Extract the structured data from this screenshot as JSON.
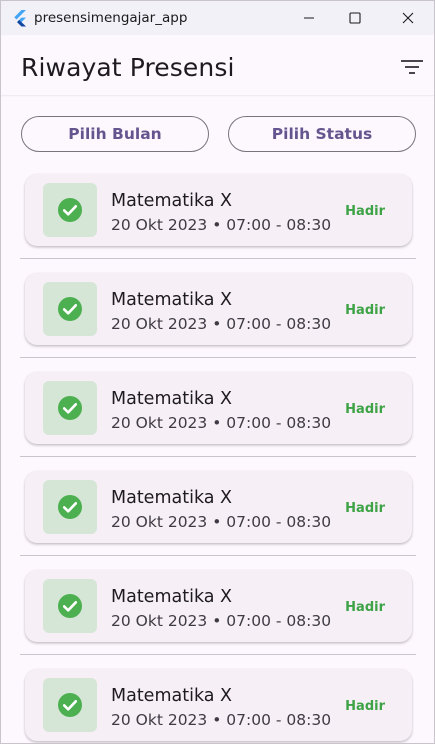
{
  "window": {
    "title": "presensimengajar_app"
  },
  "appbar": {
    "title": "Riwayat Presensi",
    "filter_icon": "filter-list-icon"
  },
  "filters": {
    "month_label": "Pilih Bulan",
    "status_label": "Pilih Status"
  },
  "colors": {
    "accent": "#65558f",
    "present": "#4caf50",
    "present_bg": "#d5e6d6",
    "card_bg": "#f6eff6"
  },
  "records": [
    {
      "subject": "Matematika X",
      "schedule": "20 Okt 2023 • 07:00 - 08:30",
      "status": "Hadir",
      "icon": "check-circle-icon"
    },
    {
      "subject": "Matematika X",
      "schedule": "20 Okt 2023 • 07:00 - 08:30",
      "status": "Hadir",
      "icon": "check-circle-icon"
    },
    {
      "subject": "Matematika X",
      "schedule": "20 Okt 2023 • 07:00 - 08:30",
      "status": "Hadir",
      "icon": "check-circle-icon"
    },
    {
      "subject": "Matematika X",
      "schedule": "20 Okt 2023 • 07:00 - 08:30",
      "status": "Hadir",
      "icon": "check-circle-icon"
    },
    {
      "subject": "Matematika X",
      "schedule": "20 Okt 2023 • 07:00 - 08:30",
      "status": "Hadir",
      "icon": "check-circle-icon"
    },
    {
      "subject": "Matematika X",
      "schedule": "20 Okt 2023 • 07:00 - 08:30",
      "status": "Hadir",
      "icon": "check-circle-icon"
    }
  ]
}
